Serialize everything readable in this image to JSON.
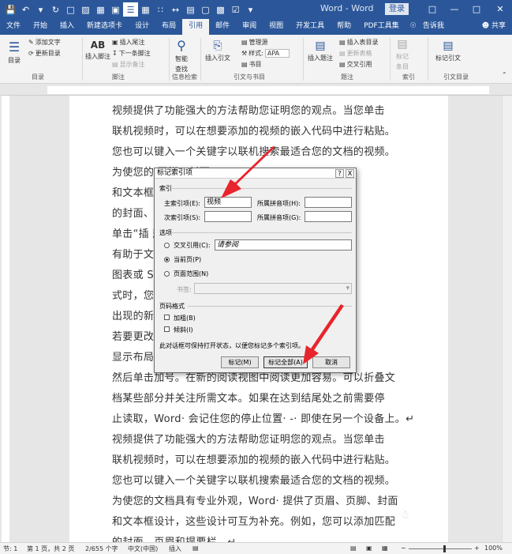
{
  "titlebar": {
    "title": "Word - Word",
    "login_label": "登录",
    "qat_icons": [
      "save-icon",
      "undo-icon",
      "redo-icon",
      "refresh-icon",
      "new-doc-icon",
      "open-folder-icon",
      "print-preview-icon",
      "document-view-icon",
      "table-icon",
      "columns-icon",
      "expand-icon",
      "ruler-icon",
      "shape-icon",
      "image-icon",
      "checkbox-icon",
      "more-icon"
    ]
  },
  "tabs": [
    {
      "label": "文件"
    },
    {
      "label": "开始"
    },
    {
      "label": "插入"
    },
    {
      "label": "新建选项卡"
    },
    {
      "label": "设计"
    },
    {
      "label": "布局"
    },
    {
      "label": "引用"
    },
    {
      "label": "邮件"
    },
    {
      "label": "审阅"
    },
    {
      "label": "视图"
    },
    {
      "label": "开发工具"
    },
    {
      "label": "帮助"
    },
    {
      "label": "PDF工具集"
    },
    {
      "label": "告诉我"
    },
    {
      "label": "共享"
    }
  ],
  "ribbon": {
    "toc": {
      "big": "目录",
      "add_text": "添加文字",
      "update": "更新目录",
      "group": "目录"
    },
    "footnote": {
      "big": "插入脚注",
      "ab": "AB",
      "insert_endnote": "插入尾注",
      "next_footnote": "下一条脚注",
      "show_notes": "显示备注",
      "group": "脚注"
    },
    "research": {
      "big_line1": "智能",
      "big_line2": "查找",
      "group": "信息检索"
    },
    "citation": {
      "big": "插入引文",
      "manage": "管理源",
      "style_label": "样式:",
      "style_value": "APA",
      "bib": "书目",
      "group": "引文与书目"
    },
    "caption": {
      "big": "插入题注",
      "insert_table": "插入表目录",
      "update_table": "更新表格",
      "cross_ref": "交叉引用",
      "group": "题注"
    },
    "index": {
      "big_line1": "标记",
      "big_line2": "条目",
      "group": "索引"
    },
    "toa": {
      "big": "标记引文",
      "group": "引文目录"
    }
  },
  "document": {
    "lines": [
      "视频提供了功能强大的方法帮助您证明您的观点。当您单击",
      "联机视频时，可以在想要添加的视频的嵌入代码中进行粘贴。",
      "您也可以键入一个关键字以联机搜索最适合您的文档的视频。",
      "为使您的                                     页脚、封面",
      "和文本框                                     以添加匹配",
      "的封面、",
      "单击“插                                      题和样式也",
      "有助于文                                     题时，图片、",
      "图表或 S                                     当应用样",
      "式时，您                                     在需要位置",
      "出现的新",
      "若要更改                                     旁边将会",
      "显示布局                                     成列的位置，",
      "然后单击加号。在新的阅读视图中阅读更加容易。可以折叠文",
      "档某些部分并关注所需文本。如果在达到结尾处之前需要停",
      "止读取，Word· 会记住您的停止位置· -· 即使在另一个设备上。↵",
      "视频提供了功能强大的方法帮助您证明您的观点。当您单击",
      "联机视频时，可以在想要添加的视频的嵌入代码中进行粘贴。",
      "您也可以键入一个关键字以联机搜索最适合您的文档的视频。",
      "为使您的文档具有专业外观，Word· 提供了页眉、页脚、封面",
      "和文本框设计，这些设计可互为补充。例如，您可以添加匹配",
      "的封面、页眉和提要栏。↵"
    ]
  },
  "dialog": {
    "title": "标记索引项",
    "help": "?",
    "close": "X",
    "index_group": "索引",
    "main_entry_label": "主索引项(E):",
    "main_entry_value": "视频",
    "main_pinyin_label": "所属拼音项(H):",
    "main_pinyin_value": "",
    "sub_entry_label": "次索引项(S):",
    "sub_entry_value": "",
    "sub_pinyin_label": "所属拼音项(G):",
    "sub_pinyin_value": "",
    "options_group": "选项",
    "cross_ref_label": "交叉引用(C):",
    "cross_ref_value": "请参阅",
    "current_page_label": "当前页(P)",
    "page_range_label": "页面范围(N)",
    "bookmark_label": "书签:",
    "page_format_group": "页码格式",
    "bold_label": "加粗(B)",
    "italic_label": "倾斜(I)",
    "note": "此对话框可保持打开状态，以便您标记多个索引项。",
    "mark_button": "标记(M)",
    "mark_all_button": "标记全部(A)",
    "cancel_button": "取消",
    "selected_option": "当前页(P)",
    "bold_checked": false,
    "italic_checked": false
  },
  "statusbar": {
    "section": "节: 1",
    "page": "第 1 页，共 2 页",
    "words": "2/655 个字",
    "language": "中文(中国)",
    "mode": "插入",
    "zoom": "100%"
  },
  "colors": {
    "accent": "#2b579a",
    "arrow": "#e8242c"
  }
}
